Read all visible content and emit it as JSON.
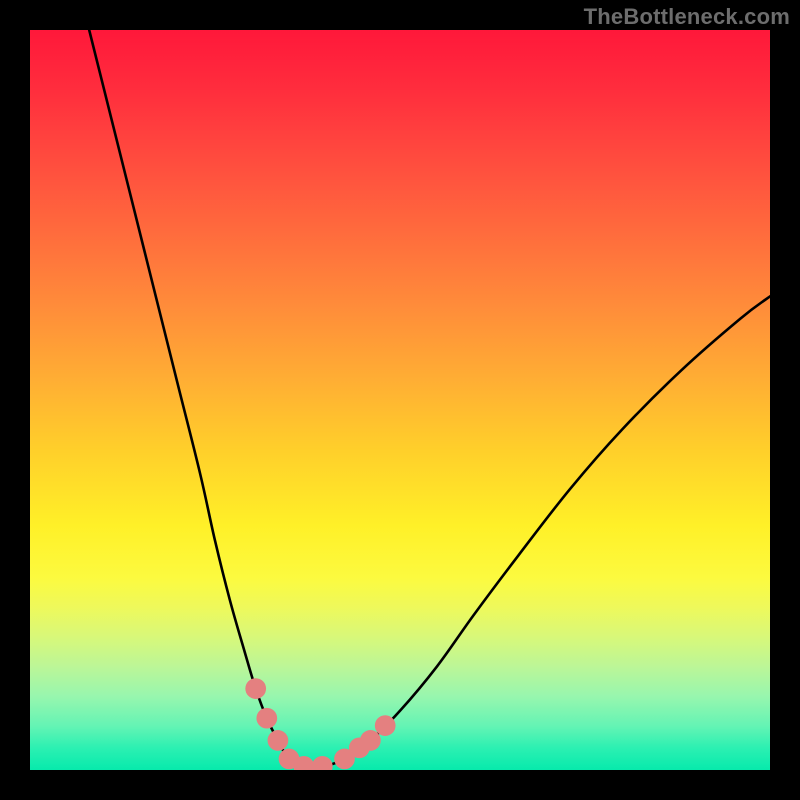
{
  "watermark": "TheBottleneck.com",
  "chart_data": {
    "type": "line",
    "title": "",
    "xlabel": "",
    "ylabel": "",
    "xlim": [
      0,
      100
    ],
    "ylim": [
      0,
      100
    ],
    "grid": false,
    "series": [
      {
        "name": "bottleneck-curve",
        "color": "#000000",
        "x": [
          8,
          11,
          14,
          17,
          20,
          23,
          25,
          27,
          29,
          30.5,
          32,
          33.5,
          35,
          37,
          39.5,
          42.5,
          46,
          50,
          55,
          60,
          66,
          73,
          80,
          88,
          96,
          100
        ],
        "y": [
          100,
          88,
          76,
          64,
          52,
          40,
          31,
          23,
          16,
          11,
          7,
          4,
          1.5,
          0.5,
          0.5,
          1.5,
          4,
          8,
          14,
          21,
          29,
          38,
          46,
          54,
          61,
          64
        ]
      }
    ],
    "markers": {
      "name": "highlighted-points",
      "color": "#e48080",
      "radius_pct": 1.4,
      "points": [
        {
          "x": 30.5,
          "y": 11
        },
        {
          "x": 32,
          "y": 7
        },
        {
          "x": 33.5,
          "y": 4
        },
        {
          "x": 35,
          "y": 1.5
        },
        {
          "x": 37,
          "y": 0.5
        },
        {
          "x": 39.5,
          "y": 0.5
        },
        {
          "x": 42.5,
          "y": 1.5
        },
        {
          "x": 44.5,
          "y": 3
        },
        {
          "x": 46,
          "y": 4
        },
        {
          "x": 48,
          "y": 6
        }
      ]
    }
  }
}
